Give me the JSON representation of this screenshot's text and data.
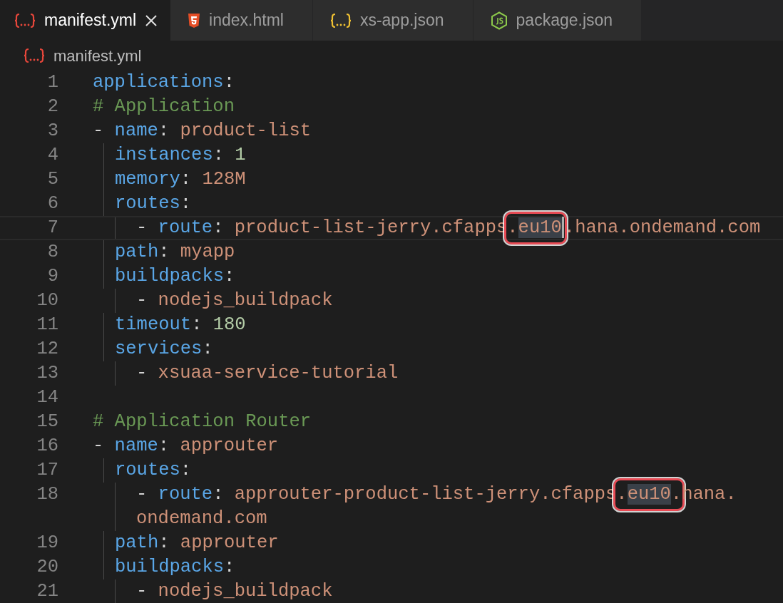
{
  "tabs": [
    {
      "label": "manifest.yml",
      "kind": "yaml",
      "selected": true
    },
    {
      "label": "index.html",
      "kind": "html",
      "selected": false
    },
    {
      "label": "xs-app.json",
      "kind": "json",
      "selected": false
    },
    {
      "label": "package.json",
      "kind": "node",
      "selected": false
    }
  ],
  "breadcrumb": {
    "kind": "yaml",
    "label": "manifest.yml"
  },
  "lines": [
    {
      "number": "1",
      "current": false,
      "tokens": [
        {
          "kind": "key",
          "text": "applications"
        },
        {
          "kind": "punct",
          "text": ":"
        }
      ]
    },
    {
      "number": "2",
      "current": false,
      "tokens": [
        {
          "kind": "comment",
          "text": "# Application"
        }
      ]
    },
    {
      "number": "3",
      "current": false,
      "tokens": [
        {
          "kind": "punct",
          "text": "- "
        },
        {
          "kind": "key",
          "text": "name"
        },
        {
          "kind": "punct",
          "text": ": "
        },
        {
          "kind": "string",
          "text": "product-list"
        }
      ]
    },
    {
      "number": "4",
      "current": false,
      "tokens": [
        {
          "kind": "key",
          "text": "  instances"
        },
        {
          "kind": "punct",
          "text": ": "
        },
        {
          "kind": "number",
          "text": "1"
        }
      ]
    },
    {
      "number": "5",
      "current": false,
      "tokens": [
        {
          "kind": "key",
          "text": "  memory"
        },
        {
          "kind": "punct",
          "text": ": "
        },
        {
          "kind": "string",
          "text": "128M"
        }
      ]
    },
    {
      "number": "6",
      "current": false,
      "tokens": [
        {
          "kind": "key",
          "text": "  routes"
        },
        {
          "kind": "punct",
          "text": ":"
        }
      ]
    },
    {
      "number": "7",
      "current": true,
      "tokens": [
        {
          "kind": "punct",
          "text": "    - "
        },
        {
          "kind": "key",
          "text": "route"
        },
        {
          "kind": "punct",
          "text": ": "
        },
        {
          "kind": "string",
          "text": "product-list-jerry.cfapps"
        },
        {
          "kind": "string",
          "text": ".",
          "boxed": true
        },
        {
          "kind": "match",
          "text": "eu10",
          "boxed": true,
          "cursor": true
        },
        {
          "kind": "string",
          "text": ".hana.ondemand.com"
        }
      ]
    },
    {
      "number": "8",
      "current": false,
      "tokens": [
        {
          "kind": "key",
          "text": "  path"
        },
        {
          "kind": "punct",
          "text": ": "
        },
        {
          "kind": "string",
          "text": "myapp"
        }
      ]
    },
    {
      "number": "9",
      "current": false,
      "tokens": [
        {
          "kind": "key",
          "text": "  buildpacks"
        },
        {
          "kind": "punct",
          "text": ":"
        }
      ]
    },
    {
      "number": "10",
      "current": false,
      "tokens": [
        {
          "kind": "punct",
          "text": "    - "
        },
        {
          "kind": "string",
          "text": "nodejs_buildpack"
        }
      ]
    },
    {
      "number": "11",
      "current": false,
      "tokens": [
        {
          "kind": "key",
          "text": "  timeout"
        },
        {
          "kind": "punct",
          "text": ": "
        },
        {
          "kind": "number",
          "text": "180"
        }
      ]
    },
    {
      "number": "12",
      "current": false,
      "tokens": [
        {
          "kind": "key",
          "text": "  services"
        },
        {
          "kind": "punct",
          "text": ":"
        }
      ]
    },
    {
      "number": "13",
      "current": false,
      "tokens": [
        {
          "kind": "punct",
          "text": "    - "
        },
        {
          "kind": "string",
          "text": "xsuaa-service-tutorial"
        }
      ]
    },
    {
      "number": "14",
      "current": false
    },
    {
      "number": "15",
      "current": false,
      "tokens": [
        {
          "kind": "comment",
          "text": "# Application Router"
        }
      ]
    },
    {
      "number": "16",
      "current": false,
      "tokens": [
        {
          "kind": "punct",
          "text": "- "
        },
        {
          "kind": "key",
          "text": "name"
        },
        {
          "kind": "punct",
          "text": ": "
        },
        {
          "kind": "string",
          "text": "approuter"
        }
      ]
    },
    {
      "number": "17",
      "current": false,
      "tokens": [
        {
          "kind": "key",
          "text": "  routes"
        },
        {
          "kind": "punct",
          "text": ":"
        }
      ]
    },
    {
      "number": "18",
      "current": false,
      "tokens": [
        {
          "kind": "punct",
          "text": "    - "
        },
        {
          "kind": "key",
          "text": "route"
        },
        {
          "kind": "punct",
          "text": ": "
        },
        {
          "kind": "string",
          "text": "approuter-product-list-jerry.cfapps"
        },
        {
          "kind": "string",
          "text": ".",
          "boxed": true
        },
        {
          "kind": "match",
          "text": "eu10",
          "boxed": true
        },
        {
          "kind": "string",
          "text": ".",
          "boxed": true
        },
        {
          "kind": "string",
          "text": "hana."
        }
      ],
      "wrapped": [
        {
          "kind": "string",
          "text": "    ondemand.com"
        }
      ]
    },
    {
      "number": "19",
      "current": false,
      "tokens": [
        {
          "kind": "key",
          "text": "  path"
        },
        {
          "kind": "punct",
          "text": ": "
        },
        {
          "kind": "string",
          "text": "approuter"
        }
      ]
    },
    {
      "number": "20",
      "current": false,
      "tokens": [
        {
          "kind": "key",
          "text": "  buildpacks"
        },
        {
          "kind": "punct",
          "text": ":"
        }
      ]
    },
    {
      "number": "21",
      "current": false,
      "tokens": [
        {
          "kind": "punct",
          "text": "    - "
        },
        {
          "kind": "string",
          "text": "nodejs_buildpack"
        }
      ]
    }
  ]
}
